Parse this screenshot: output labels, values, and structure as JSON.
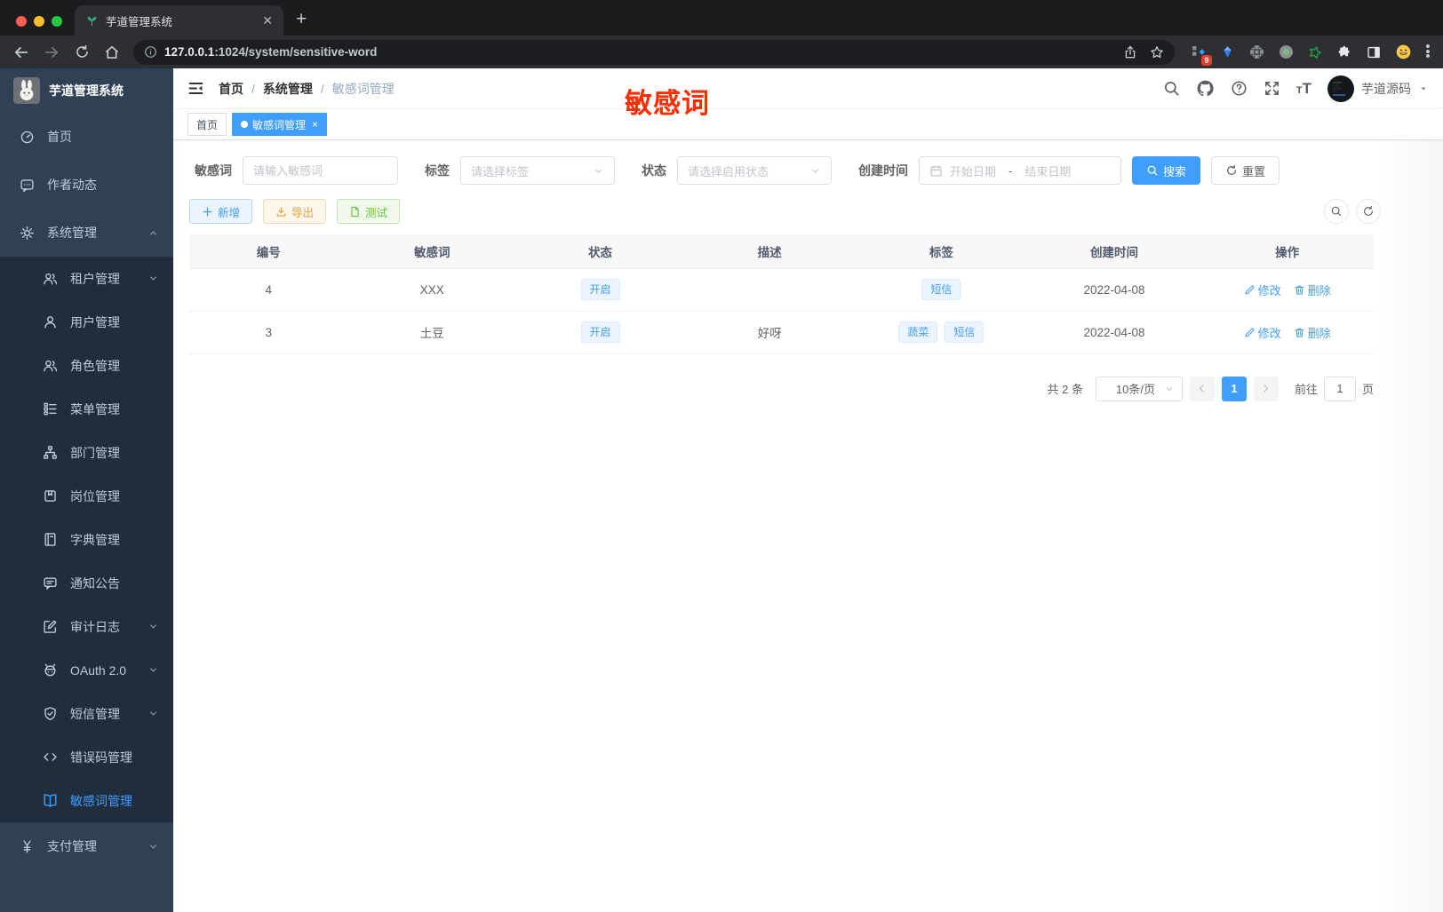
{
  "browser": {
    "tab_title": "芋道管理系统",
    "url_host": "127.0.0.1",
    "url_rest": ":1024/system/sensitive-word",
    "extension_badge": "9"
  },
  "sidebar": {
    "app_title": "芋道管理系统",
    "items": [
      {
        "name": "home",
        "label": "首页",
        "icon": "dashboard-icon",
        "level": 1
      },
      {
        "name": "author-news",
        "label": "作者动态",
        "icon": "chat-icon",
        "level": 1
      },
      {
        "name": "system",
        "label": "系统管理",
        "icon": "gear-icon",
        "level": 1,
        "arrow": "up"
      },
      {
        "name": "tenant",
        "label": "租户管理",
        "icon": "users-icon",
        "level": 2,
        "arrow": "down"
      },
      {
        "name": "user",
        "label": "用户管理",
        "icon": "user-icon",
        "level": 2
      },
      {
        "name": "role",
        "label": "角色管理",
        "icon": "users-icon",
        "level": 2
      },
      {
        "name": "menu",
        "label": "菜单管理",
        "icon": "tree-list-icon",
        "level": 2
      },
      {
        "name": "dept",
        "label": "部门管理",
        "icon": "org-chart-icon",
        "level": 2
      },
      {
        "name": "post",
        "label": "岗位管理",
        "icon": "badge-icon",
        "level": 2
      },
      {
        "name": "dict",
        "label": "字典管理",
        "icon": "book-icon",
        "level": 2
      },
      {
        "name": "notice",
        "label": "通知公告",
        "icon": "comment-icon",
        "level": 2
      },
      {
        "name": "audit-log",
        "label": "审计日志",
        "icon": "edit-log-icon",
        "level": 2,
        "arrow": "down"
      },
      {
        "name": "oauth2",
        "label": "OAuth 2.0",
        "icon": "robot-icon",
        "level": 2,
        "arrow": "down"
      },
      {
        "name": "sms",
        "label": "短信管理",
        "icon": "shield-check-icon",
        "level": 2,
        "arrow": "down"
      },
      {
        "name": "error-code",
        "label": "错误码管理",
        "icon": "code-icon",
        "level": 2
      },
      {
        "name": "sensitive-word",
        "label": "敏感词管理",
        "icon": "open-book-icon",
        "level": 2,
        "active": true
      },
      {
        "name": "pay",
        "label": "支付管理",
        "icon": "yen-icon",
        "level": 1,
        "arrow": "down"
      }
    ]
  },
  "header": {
    "breadcrumb": [
      "首页",
      "系统管理",
      "敏感词管理"
    ],
    "separator": "/",
    "username": "芋道源码",
    "overlay_text": "敏感词"
  },
  "tags_view": {
    "tags": [
      {
        "label": "首页",
        "active": false,
        "closable": false
      },
      {
        "label": "敏感词管理",
        "active": true,
        "closable": true
      }
    ]
  },
  "filters": {
    "keyword_label": "敏感词",
    "keyword_placeholder": "请输入敏感词",
    "tag_label": "标签",
    "tag_placeholder": "请选择标签",
    "status_label": "状态",
    "status_placeholder": "请选择启用状态",
    "date_label": "创建时间",
    "date_start_placeholder": "开始日期",
    "date_separator": "-",
    "date_end_placeholder": "结束日期",
    "search_label": "搜索",
    "reset_label": "重置"
  },
  "toolbar": {
    "add_label": "新增",
    "export_label": "导出",
    "test_label": "测试"
  },
  "table": {
    "headers": [
      "编号",
      "敏感词",
      "状态",
      "描述",
      "标签",
      "创建时间",
      "操作"
    ],
    "rows": [
      {
        "id": "4",
        "word": "XXX",
        "status": "开启",
        "description": "",
        "tags": [
          "短信"
        ],
        "create_time": "2022-04-08"
      },
      {
        "id": "3",
        "word": "土豆",
        "status": "开启",
        "description": "好呀",
        "tags": [
          "蔬菜",
          "短信"
        ],
        "create_time": "2022-04-08"
      }
    ],
    "edit_label": "修改",
    "delete_label": "删除"
  },
  "pagination": {
    "total_text": "共 2 条",
    "page_size_text": "10条/页",
    "current_page": "1",
    "goto_text": "前往",
    "goto_value": "1",
    "page_unit": "页"
  },
  "colors": {
    "primary": "#409eff",
    "sidebar_bg": "#304156",
    "submenu_bg": "#1f2d3d",
    "sidebar_text": "#bfcbd9",
    "warning": "#e6a23c",
    "success": "#67c23a",
    "overlay_red": "#ff2d00",
    "tag_bg": "#ecf5ff",
    "tag_border": "#d9ecff"
  }
}
